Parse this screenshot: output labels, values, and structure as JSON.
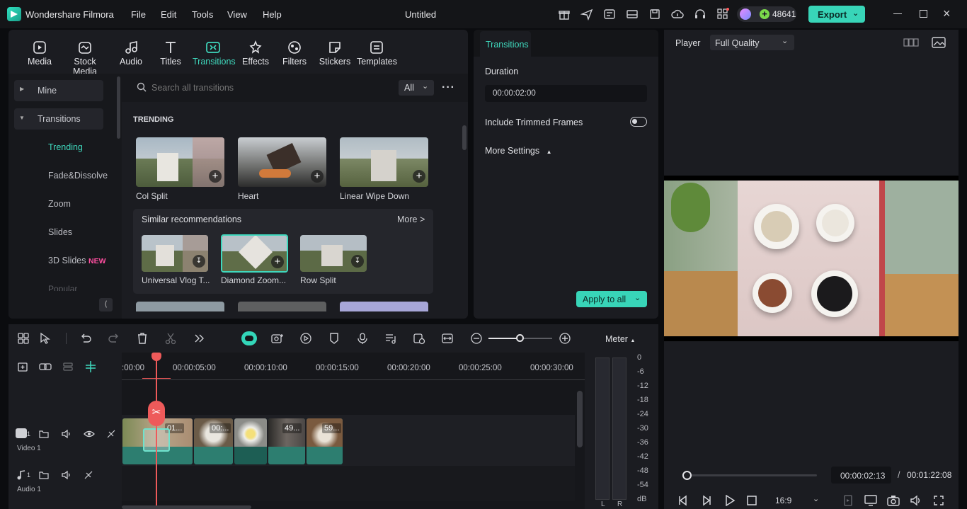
{
  "app": {
    "name": "Wondershare Filmora",
    "doc_title": "Untitled",
    "credits": "48641",
    "export_label": "Export"
  },
  "menu": [
    "File",
    "Edit",
    "Tools",
    "View",
    "Help"
  ],
  "tool_tabs": [
    "Media",
    "Stock Media",
    "Audio",
    "Titles",
    "Transitions",
    "Effects",
    "Filters",
    "Stickers",
    "Templates"
  ],
  "sidebar": {
    "items": [
      "Mine",
      "Transitions",
      "Trending",
      "Fade&Dissolve",
      "Zoom",
      "Slides",
      "3D Slides",
      "Popular"
    ],
    "new_badge": "NEW"
  },
  "search": {
    "placeholder": "Search all transitions",
    "filter": "All"
  },
  "trending": {
    "heading": "TRENDING",
    "items": [
      "Col Split",
      "Heart",
      "Linear Wipe Down"
    ]
  },
  "similar": {
    "heading": "Similar recommendations",
    "more": "More >",
    "items": [
      "Universal Vlog T...",
      "Diamond Zoom...",
      "Row Split"
    ]
  },
  "props": {
    "tab": "Transitions",
    "duration_label": "Duration",
    "duration_value": "00:00:02:00",
    "trim_label": "Include Trimmed Frames",
    "trim_on": false,
    "more_settings": "More Settings",
    "apply_all": "Apply to all"
  },
  "player": {
    "label": "Player",
    "quality": "Full Quality",
    "current_time": "00:00:02:13",
    "separator": "/",
    "total_time": "00:01:22:08",
    "aspect": "16:9",
    "progress": 0.03
  },
  "timeline": {
    "ruler": [
      ":00:00",
      "00:00:05:00",
      "00:00:10:00",
      "00:00:15:00",
      "00:00:20:00",
      "00:00:25:00",
      "00:00:30:00"
    ],
    "tracks": {
      "video": "Video 1",
      "video_num": "1",
      "audio": "Audio 1",
      "audio_num": "1"
    },
    "clips": [
      "01...",
      "00:...",
      "",
      "49...",
      "59..."
    ],
    "meter": "Meter",
    "db_scale": [
      "0",
      "-6",
      "-12",
      "-18",
      "-24",
      "-30",
      "-36",
      "-42",
      "-48",
      "-54",
      "dB"
    ],
    "lr": [
      "L",
      "R"
    ]
  },
  "colors": {
    "accent": "#3fd8bd",
    "playhead": "#ee5a5a",
    "panel": "#1b1c21"
  }
}
